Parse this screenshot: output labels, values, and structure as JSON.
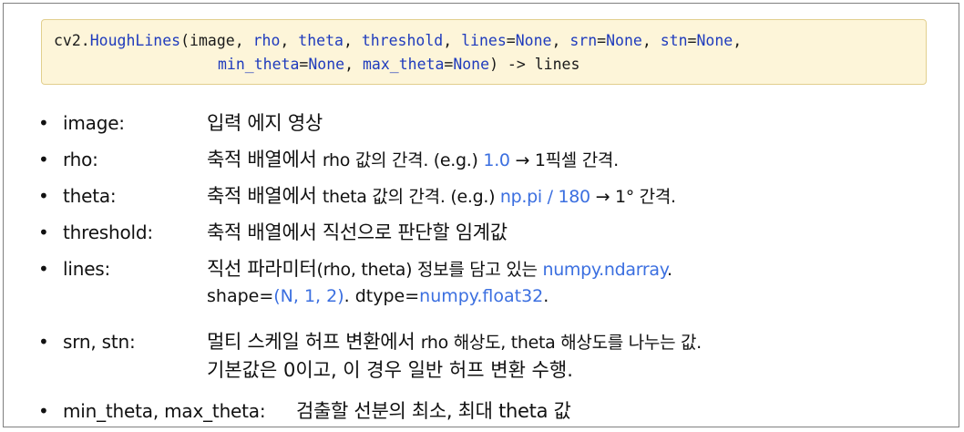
{
  "signature": {
    "line1": {
      "fn_prefix": "cv2.",
      "fn_name": "HoughLines",
      "open": "(",
      "args_a": "image, ",
      "arg_rho": "rho",
      "sep1": ", ",
      "arg_theta": "theta",
      "sep2": ", ",
      "arg_threshold": "threshold",
      "sep3": ", ",
      "kw_lines": "lines",
      "eq1": "=",
      "none1": "None",
      "sep4": ", ",
      "kw_srn": "srn",
      "eq2": "=",
      "none2": "None",
      "sep5": ", ",
      "kw_stn": "stn",
      "eq3": "=",
      "none3": "None",
      "sep6": ","
    },
    "line2": {
      "kw_min_theta": "min_theta",
      "eq1": "=",
      "none1": "None",
      "sep1": ", ",
      "kw_max_theta": "max_theta",
      "eq2": "=",
      "none2": "None",
      "close": ") -> lines"
    }
  },
  "bullet_char": "•",
  "params": [
    {
      "name": "image:",
      "desc": "입력 에지 영상"
    },
    {
      "name": "rho:",
      "desc_a": "축적 배열에서 ",
      "desc_b": "rho 값의 간격. (e.g.) ",
      "desc_blue": "1.0",
      "desc_c": " → 1픽셀 간격."
    },
    {
      "name": "theta:",
      "desc_a": "축적 배열에서 ",
      "desc_b": "theta 값의 간격. (e.g.) ",
      "desc_blue": "np.pi / 180",
      "desc_c": " → 1° 간격."
    },
    {
      "name": "threshold:",
      "desc": "축적 배열에서 직선으로 판단할 임계값"
    },
    {
      "name": "lines:",
      "desc_a": "직선 파라미터",
      "desc_b": "(rho, theta) 정보를 담고 있는 ",
      "desc_blue": "numpy.ndarray",
      "desc_c": ".",
      "cont_a": "shape=",
      "cont_blue1": "(N, 1, 2)",
      "cont_b": ". dtype=",
      "cont_blue2": "numpy.float32",
      "cont_c": "."
    },
    {
      "name": "srn, stn:",
      "desc_a": "멀티 스케일 허프 변환에서 ",
      "desc_b": "rho 해상도, theta 해상도를 나누는 값.",
      "cont": "기본값은 0이고, 이 경우 일반 허프 변환 수행."
    },
    {
      "name": "min_theta, max_theta:",
      "desc": "검출할 선분의 최소, 최대 theta 값"
    }
  ]
}
